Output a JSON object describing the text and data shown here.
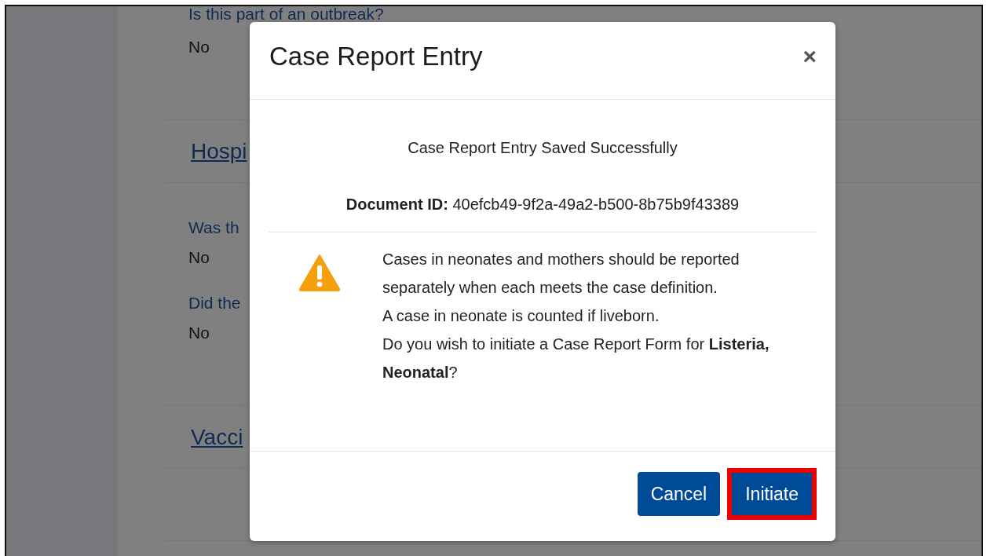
{
  "background_page": {
    "items": [
      {
        "kind": "field",
        "label": "Is this part of an outbreak?",
        "value": "No"
      },
      {
        "kind": "heading",
        "text": "Hospi"
      },
      {
        "kind": "field",
        "label": "Was th",
        "value": "No"
      },
      {
        "kind": "field",
        "label": "Did the",
        "value": "No"
      },
      {
        "kind": "heading",
        "text": "Vacci"
      }
    ]
  },
  "modal": {
    "title": "Case Report Entry",
    "close": "×",
    "success_message": "Case Report Entry Saved Successfully",
    "document_id": {
      "label": "Document ID:",
      "value": "40efcb49-9f2a-49a2-b500-8b75b9f43389"
    },
    "warning": {
      "lines": [
        "Cases in neonates and mothers should be reported separately when each meets the case definition.",
        "A case in neonate is counted if liveborn.",
        "Do you wish to initiate a Case Report Form for **Listeria, Neonatal**?"
      ]
    },
    "buttons": [
      {
        "label": "Cancel",
        "highlighted": false
      },
      {
        "label": "Initiate",
        "highlighted": true
      }
    ]
  }
}
